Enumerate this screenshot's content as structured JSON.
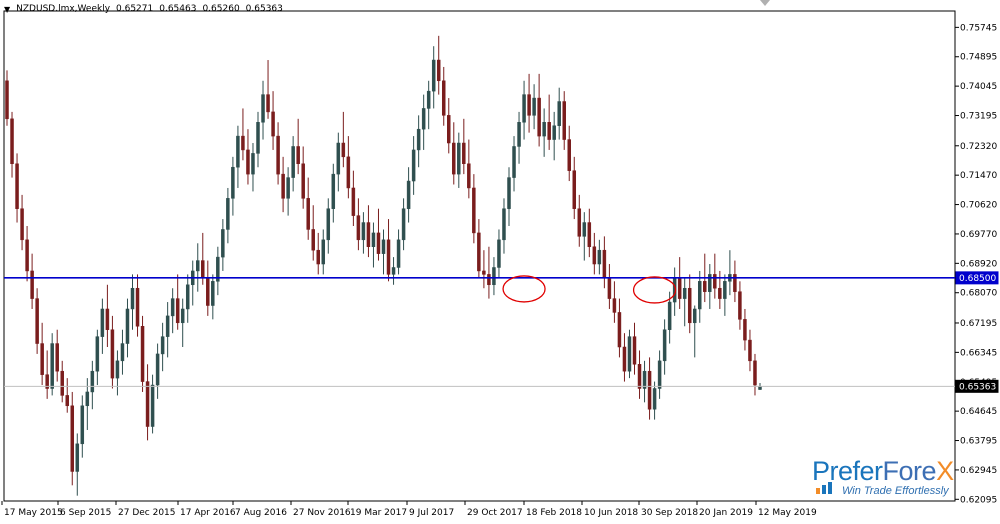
{
  "header": {
    "symbol": "NZDUSD.lmx,Weekly",
    "open": "0.65271",
    "high": "0.65463",
    "low": "0.65260",
    "close": "0.65363"
  },
  "logo": {
    "name_part1": "Prefer",
    "name_part2": "Fore",
    "name_part3": "X",
    "tagline": "Win Trade Effortlessly"
  },
  "colors": {
    "bull": "#2f4f4f",
    "bear": "#7a1d1d",
    "support_line": "#0000cc",
    "current_line": "#c0c0c0",
    "annotation": "#e00000",
    "grid_frame": "#000000"
  },
  "chart_data": {
    "type": "candlestick",
    "title": "",
    "ylim": [
      0.62075,
      0.759
    ],
    "y_ticks": [
      "0.75745",
      "0.74895",
      "0.74045",
      "0.73195",
      "0.72320",
      "0.71470",
      "0.70620",
      "0.69770",
      "0.68920",
      "0.68070",
      "0.67195",
      "0.66345",
      "0.65495",
      "0.64645",
      "0.63795",
      "0.62945",
      "0.62095"
    ],
    "x_labels": [
      "17 May 2015",
      "6 Sep 2015",
      "27 Dec 2015",
      "17 Apr 2016",
      "7 Aug 2016",
      "27 Nov 2016",
      "19 Mar 2017",
      "9 Jul 2017",
      "29 Oct 2017",
      "18 Feb 2018",
      "10 Jun 2018",
      "30 Sep 2018",
      "20 Jan 2019",
      "12 May 2019"
    ],
    "support_level": 0.685,
    "support_label": "0.68500",
    "current_price": 0.65363,
    "current_label": "0.65363",
    "annotations": [
      {
        "type": "ellipse",
        "x_date": "2017-05-07",
        "y": 0.6818
      },
      {
        "type": "ellipse",
        "x_date": "2017-11-05",
        "y": 0.6815
      }
    ],
    "candles": [
      [
        0.742,
        0.745,
        0.729,
        0.731
      ],
      [
        0.731,
        0.733,
        0.714,
        0.718
      ],
      [
        0.718,
        0.721,
        0.701,
        0.705
      ],
      [
        0.705,
        0.709,
        0.693,
        0.696
      ],
      [
        0.696,
        0.7,
        0.684,
        0.687
      ],
      [
        0.687,
        0.692,
        0.676,
        0.679
      ],
      [
        0.679,
        0.682,
        0.663,
        0.666
      ],
      [
        0.666,
        0.672,
        0.654,
        0.657
      ],
      [
        0.657,
        0.664,
        0.65,
        0.653
      ],
      [
        0.653,
        0.669,
        0.651,
        0.666
      ],
      [
        0.666,
        0.67,
        0.655,
        0.658
      ],
      [
        0.658,
        0.661,
        0.649,
        0.651
      ],
      [
        0.651,
        0.656,
        0.646,
        0.648
      ],
      [
        0.648,
        0.652,
        0.625,
        0.629
      ],
      [
        0.629,
        0.64,
        0.622,
        0.637
      ],
      [
        0.637,
        0.651,
        0.633,
        0.648
      ],
      [
        0.648,
        0.656,
        0.641,
        0.652
      ],
      [
        0.652,
        0.661,
        0.647,
        0.658
      ],
      [
        0.658,
        0.67,
        0.654,
        0.668
      ],
      [
        0.668,
        0.679,
        0.663,
        0.676
      ],
      [
        0.676,
        0.683,
        0.665,
        0.67
      ],
      [
        0.67,
        0.674,
        0.653,
        0.656
      ],
      [
        0.656,
        0.664,
        0.651,
        0.661
      ],
      [
        0.661,
        0.67,
        0.657,
        0.666
      ],
      [
        0.666,
        0.679,
        0.662,
        0.676
      ],
      [
        0.676,
        0.686,
        0.67,
        0.682
      ],
      [
        0.682,
        0.686,
        0.668,
        0.671
      ],
      [
        0.671,
        0.674,
        0.652,
        0.655
      ],
      [
        0.655,
        0.66,
        0.638,
        0.642
      ],
      [
        0.642,
        0.657,
        0.64,
        0.654
      ],
      [
        0.654,
        0.666,
        0.65,
        0.663
      ],
      [
        0.663,
        0.672,
        0.658,
        0.668
      ],
      [
        0.668,
        0.678,
        0.662,
        0.674
      ],
      [
        0.674,
        0.682,
        0.669,
        0.679
      ],
      [
        0.679,
        0.686,
        0.67,
        0.672
      ],
      [
        0.672,
        0.679,
        0.665,
        0.676
      ],
      [
        0.676,
        0.686,
        0.672,
        0.683
      ],
      [
        0.683,
        0.69,
        0.677,
        0.687
      ],
      [
        0.687,
        0.695,
        0.681,
        0.69
      ],
      [
        0.69,
        0.698,
        0.683,
        0.685
      ],
      [
        0.685,
        0.69,
        0.674,
        0.677
      ],
      [
        0.677,
        0.686,
        0.673,
        0.684
      ],
      [
        0.684,
        0.694,
        0.68,
        0.691
      ],
      [
        0.691,
        0.702,
        0.687,
        0.699
      ],
      [
        0.699,
        0.711,
        0.695,
        0.708
      ],
      [
        0.708,
        0.72,
        0.703,
        0.717
      ],
      [
        0.717,
        0.729,
        0.711,
        0.726
      ],
      [
        0.726,
        0.734,
        0.719,
        0.722
      ],
      [
        0.722,
        0.728,
        0.712,
        0.715
      ],
      [
        0.715,
        0.724,
        0.71,
        0.721
      ],
      [
        0.721,
        0.733,
        0.717,
        0.73
      ],
      [
        0.73,
        0.742,
        0.725,
        0.738
      ],
      [
        0.738,
        0.748,
        0.731,
        0.733
      ],
      [
        0.733,
        0.739,
        0.722,
        0.726
      ],
      [
        0.726,
        0.73,
        0.712,
        0.715
      ],
      [
        0.715,
        0.72,
        0.704,
        0.708
      ],
      [
        0.708,
        0.717,
        0.703,
        0.714
      ],
      [
        0.714,
        0.726,
        0.71,
        0.723
      ],
      [
        0.723,
        0.731,
        0.715,
        0.718
      ],
      [
        0.718,
        0.723,
        0.705,
        0.708
      ],
      [
        0.708,
        0.714,
        0.696,
        0.699
      ],
      [
        0.699,
        0.706,
        0.69,
        0.693
      ],
      [
        0.693,
        0.698,
        0.686,
        0.689
      ],
      [
        0.689,
        0.699,
        0.686,
        0.696
      ],
      [
        0.696,
        0.708,
        0.692,
        0.705
      ],
      [
        0.705,
        0.718,
        0.701,
        0.715
      ],
      [
        0.715,
        0.727,
        0.71,
        0.724
      ],
      [
        0.724,
        0.733,
        0.717,
        0.72
      ],
      [
        0.72,
        0.726,
        0.708,
        0.711
      ],
      [
        0.711,
        0.716,
        0.7,
        0.703
      ],
      [
        0.703,
        0.708,
        0.693,
        0.696
      ],
      [
        0.696,
        0.704,
        0.692,
        0.701
      ],
      [
        0.701,
        0.706,
        0.691,
        0.694
      ],
      [
        0.694,
        0.701,
        0.688,
        0.698
      ],
      [
        0.698,
        0.705,
        0.69,
        0.692
      ],
      [
        0.692,
        0.699,
        0.686,
        0.696
      ],
      [
        0.696,
        0.702,
        0.684,
        0.686
      ],
      [
        0.686,
        0.691,
        0.683,
        0.688
      ],
      [
        0.688,
        0.699,
        0.686,
        0.696
      ],
      [
        0.696,
        0.708,
        0.693,
        0.705
      ],
      [
        0.705,
        0.717,
        0.701,
        0.713
      ],
      [
        0.713,
        0.726,
        0.709,
        0.722
      ],
      [
        0.722,
        0.732,
        0.717,
        0.728
      ],
      [
        0.728,
        0.738,
        0.722,
        0.734
      ],
      [
        0.734,
        0.742,
        0.728,
        0.739
      ],
      [
        0.739,
        0.752,
        0.734,
        0.748
      ],
      [
        0.748,
        0.755,
        0.738,
        0.742
      ],
      [
        0.742,
        0.746,
        0.729,
        0.732
      ],
      [
        0.732,
        0.737,
        0.721,
        0.724
      ],
      [
        0.724,
        0.73,
        0.712,
        0.715
      ],
      [
        0.715,
        0.727,
        0.711,
        0.724
      ],
      [
        0.724,
        0.731,
        0.715,
        0.718
      ],
      [
        0.718,
        0.725,
        0.708,
        0.711
      ],
      [
        0.711,
        0.715,
        0.695,
        0.698
      ],
      [
        0.698,
        0.702,
        0.685,
        0.687
      ],
      [
        0.687,
        0.693,
        0.682,
        0.686
      ],
      [
        0.686,
        0.694,
        0.679,
        0.683
      ],
      [
        0.683,
        0.691,
        0.68,
        0.688
      ],
      [
        0.688,
        0.699,
        0.685,
        0.696
      ],
      [
        0.696,
        0.708,
        0.692,
        0.705
      ],
      [
        0.705,
        0.717,
        0.7,
        0.714
      ],
      [
        0.714,
        0.726,
        0.71,
        0.723
      ],
      [
        0.723,
        0.733,
        0.718,
        0.73
      ],
      [
        0.73,
        0.742,
        0.725,
        0.738
      ],
      [
        0.738,
        0.744,
        0.727,
        0.732
      ],
      [
        0.732,
        0.741,
        0.728,
        0.737
      ],
      [
        0.737,
        0.744,
        0.723,
        0.726
      ],
      [
        0.726,
        0.734,
        0.72,
        0.73
      ],
      [
        0.73,
        0.738,
        0.722,
        0.725
      ],
      [
        0.725,
        0.733,
        0.719,
        0.729
      ],
      [
        0.729,
        0.74,
        0.725,
        0.736
      ],
      [
        0.736,
        0.739,
        0.722,
        0.725
      ],
      [
        0.725,
        0.729,
        0.713,
        0.716
      ],
      [
        0.716,
        0.72,
        0.702,
        0.705
      ],
      [
        0.705,
        0.709,
        0.694,
        0.697
      ],
      [
        0.697,
        0.704,
        0.69,
        0.701
      ],
      [
        0.701,
        0.705,
        0.691,
        0.694
      ],
      [
        0.694,
        0.698,
        0.686,
        0.689
      ],
      [
        0.689,
        0.696,
        0.686,
        0.693
      ],
      [
        0.693,
        0.697,
        0.682,
        0.685
      ],
      [
        0.685,
        0.689,
        0.676,
        0.679
      ],
      [
        0.679,
        0.684,
        0.672,
        0.675
      ],
      [
        0.675,
        0.679,
        0.662,
        0.665
      ],
      [
        0.665,
        0.669,
        0.655,
        0.658
      ],
      [
        0.658,
        0.67,
        0.656,
        0.668
      ],
      [
        0.668,
        0.672,
        0.657,
        0.66
      ],
      [
        0.66,
        0.664,
        0.65,
        0.653
      ],
      [
        0.653,
        0.661,
        0.649,
        0.658
      ],
      [
        0.658,
        0.662,
        0.644,
        0.647
      ],
      [
        0.647,
        0.655,
        0.644,
        0.653
      ],
      [
        0.653,
        0.664,
        0.65,
        0.661
      ],
      [
        0.661,
        0.673,
        0.657,
        0.67
      ],
      [
        0.67,
        0.681,
        0.666,
        0.678
      ],
      [
        0.678,
        0.688,
        0.674,
        0.685
      ],
      [
        0.685,
        0.691,
        0.676,
        0.679
      ],
      [
        0.679,
        0.685,
        0.671,
        0.682
      ],
      [
        0.682,
        0.686,
        0.669,
        0.672
      ],
      [
        0.672,
        0.677,
        0.662,
        0.676
      ],
      [
        0.676,
        0.687,
        0.672,
        0.684
      ],
      [
        0.684,
        0.692,
        0.678,
        0.681
      ],
      [
        0.681,
        0.689,
        0.676,
        0.686
      ],
      [
        0.686,
        0.692,
        0.679,
        0.682
      ],
      [
        0.682,
        0.687,
        0.676,
        0.679
      ],
      [
        0.679,
        0.686,
        0.674,
        0.684
      ],
      [
        0.684,
        0.693,
        0.68,
        0.686
      ],
      [
        0.686,
        0.69,
        0.678,
        0.681
      ],
      [
        0.681,
        0.684,
        0.67,
        0.673
      ],
      [
        0.673,
        0.676,
        0.664,
        0.667
      ],
      [
        0.667,
        0.67,
        0.658,
        0.661
      ],
      [
        0.661,
        0.663,
        0.651,
        0.654
      ],
      [
        0.6527,
        0.6546,
        0.6526,
        0.6536
      ]
    ]
  }
}
